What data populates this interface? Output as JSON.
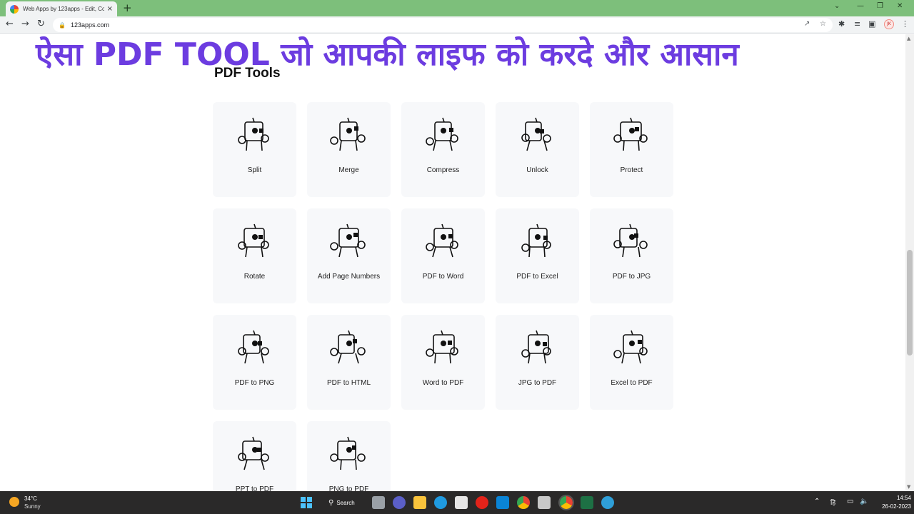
{
  "browser": {
    "tab_title": "Web Apps by 123apps - Edit, Co",
    "tab_close": "×",
    "new_tab": "+",
    "url": "123apps.com",
    "window_controls": [
      "⌄",
      "—",
      "❐",
      "✕"
    ]
  },
  "page": {
    "overlay_title": "ऐसा PDF TOOL जो आपकी लाइफ को करदे और आसान",
    "section_heading": "PDF Tools",
    "tools": [
      {
        "label": "Split",
        "icon": "split-robot-icon"
      },
      {
        "label": "Merge",
        "icon": "merge-robot-icon"
      },
      {
        "label": "Compress",
        "icon": "compress-weight-icon"
      },
      {
        "label": "Unlock",
        "icon": "unlock-figure-icon"
      },
      {
        "label": "Protect",
        "icon": "protect-robot-icon"
      },
      {
        "label": "Rotate",
        "icon": "rotate-ball-icon"
      },
      {
        "label": "Add Page Numbers",
        "icon": "page-numbers-bird-icon"
      },
      {
        "label": "PDF to Word",
        "icon": "pdf-to-word-icon"
      },
      {
        "label": "PDF to Excel",
        "icon": "pdf-to-excel-icon"
      },
      {
        "label": "PDF to JPG",
        "icon": "pdf-to-jpg-icon"
      },
      {
        "label": "PDF to PNG",
        "icon": "pdf-to-png-icon"
      },
      {
        "label": "PDF to HTML",
        "icon": "pdf-to-html-icon"
      },
      {
        "label": "Word to PDF",
        "icon": "word-to-pdf-icon"
      },
      {
        "label": "JPG to PDF",
        "icon": "jpg-to-pdf-icon"
      },
      {
        "label": "Excel to PDF",
        "icon": "excel-to-pdf-icon"
      },
      {
        "label": "PPT to PDF",
        "icon": "ppt-to-pdf-icon"
      },
      {
        "label": "PNG to PDF",
        "icon": "png-to-pdf-icon"
      }
    ]
  },
  "taskbar": {
    "temperature": "34°C",
    "condition": "Sunny",
    "search_label": "Search",
    "time": "14:54",
    "date": "26-02-2023",
    "language": "हि"
  },
  "colors": {
    "overlay_text": "#6c3ce0",
    "tab_strip": "#7dbf7b",
    "card_bg": "#f7f8fa",
    "taskbar": "#2a2929"
  }
}
